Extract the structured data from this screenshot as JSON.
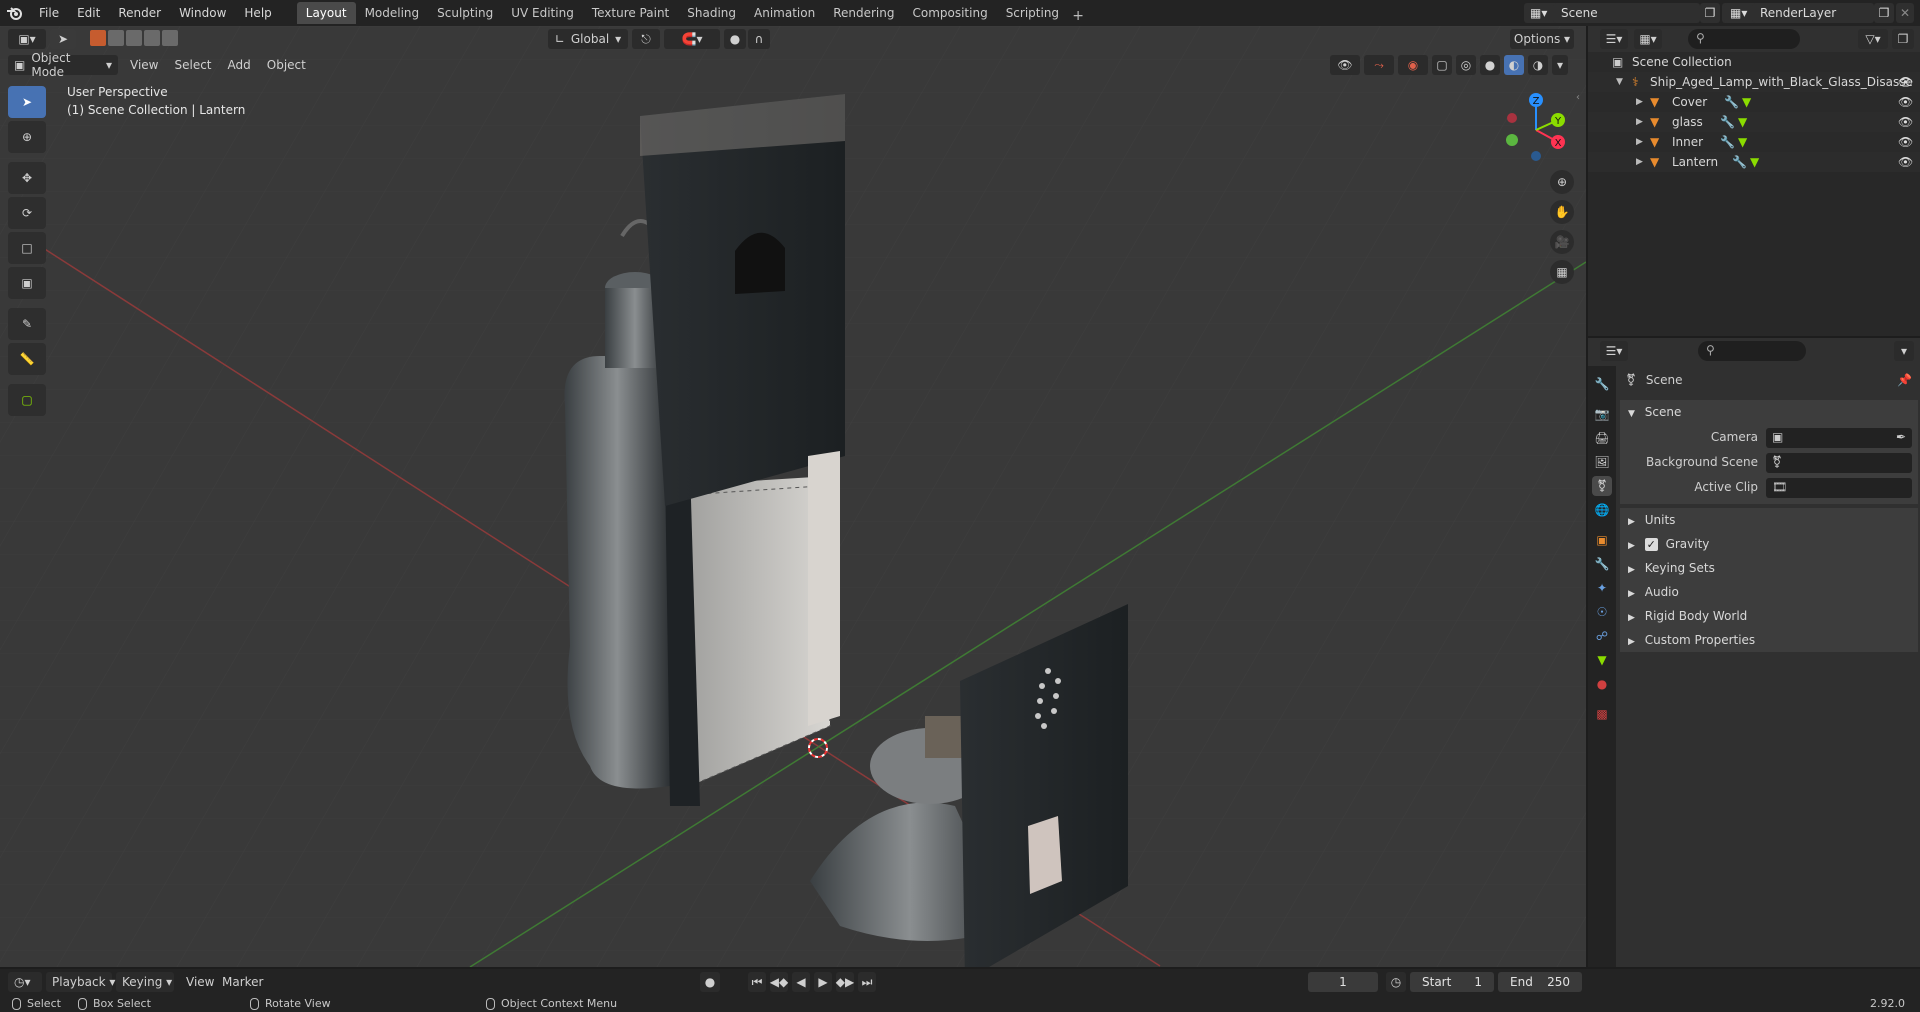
{
  "topbar": {
    "menus": [
      "File",
      "Edit",
      "Render",
      "Window",
      "Help"
    ],
    "workspaces": [
      "Layout",
      "Modeling",
      "Sculpting",
      "UV Editing",
      "Texture Paint",
      "Shading",
      "Animation",
      "Rendering",
      "Compositing",
      "Scripting"
    ],
    "active_workspace": "Layout",
    "add_tab": "+",
    "scene_name": "Scene",
    "view_layer": "RenderLayer"
  },
  "viewport": {
    "mode": "Object Mode",
    "menus": [
      "View",
      "Select",
      "Add",
      "Object"
    ],
    "transform_orientation": "Global",
    "options_label": "Options",
    "perspective_label": "User Perspective",
    "collection_label": "(1) Scene Collection | Lantern",
    "gizmo_axes": {
      "x": "X",
      "y": "Y",
      "z": "Z"
    }
  },
  "outliner": {
    "root": "Scene Collection",
    "collection": "Ship_Aged_Lamp_with_Black_Glass_Disasse",
    "objects": [
      "Cover",
      "glass",
      "Inner",
      "Lantern"
    ]
  },
  "properties": {
    "header": "Scene",
    "panel_title": "Scene",
    "fields": [
      {
        "label": "Camera"
      },
      {
        "label": "Background Scene"
      },
      {
        "label": "Active Clip"
      }
    ],
    "subpanels": [
      "Units",
      "Gravity",
      "Keying Sets",
      "Audio",
      "Rigid Body World",
      "Custom Properties"
    ],
    "gravity_checked": true
  },
  "timeline": {
    "menus": [
      "Playback",
      "Keying",
      "View",
      "Marker"
    ],
    "current_frame": "1",
    "start_label": "Start",
    "start_value": "1",
    "end_label": "End",
    "end_value": "250"
  },
  "statusbar": {
    "select": "Select",
    "box_select": "Box Select",
    "rotate_view": "Rotate View",
    "context_menu": "Object Context Menu",
    "version": "2.92.0"
  },
  "colors": {
    "accent": "#4772b3",
    "axis_x": "#ff3352",
    "axis_y": "#8bdc00",
    "axis_z": "#2890ff",
    "object_orange": "#e88b2e"
  }
}
